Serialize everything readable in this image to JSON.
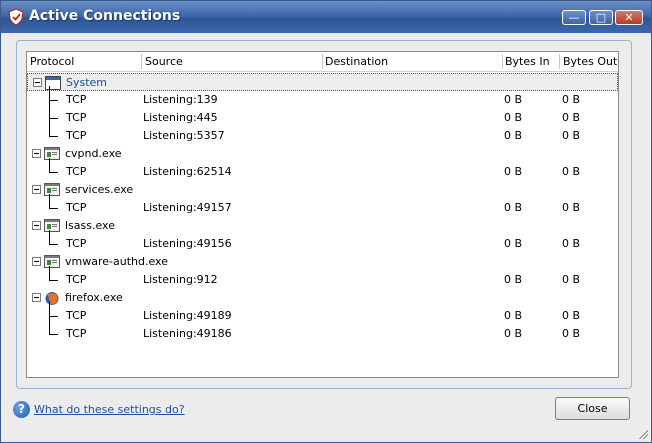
{
  "window": {
    "title": "Active Connections"
  },
  "columns": [
    "Protocol",
    "Source",
    "Destination",
    "Bytes In",
    "Bytes Out"
  ],
  "processes": [
    {
      "name": "System",
      "icon": "window-icon",
      "selected": true,
      "connections": [
        {
          "protocol": "TCP",
          "source": "Listening:139",
          "destination": "",
          "bytes_in": "0 B",
          "bytes_out": "0 B"
        },
        {
          "protocol": "TCP",
          "source": "Listening:445",
          "destination": "",
          "bytes_in": "0 B",
          "bytes_out": "0 B"
        },
        {
          "protocol": "TCP",
          "source": "Listening:5357",
          "destination": "",
          "bytes_in": "0 B",
          "bytes_out": "0 B"
        }
      ]
    },
    {
      "name": "cvpnd.exe",
      "icon": "app-icon",
      "connections": [
        {
          "protocol": "TCP",
          "source": "Listening:62514",
          "destination": "",
          "bytes_in": "0 B",
          "bytes_out": "0 B"
        }
      ]
    },
    {
      "name": "services.exe",
      "icon": "app-icon",
      "connections": [
        {
          "protocol": "TCP",
          "source": "Listening:49157",
          "destination": "",
          "bytes_in": "0 B",
          "bytes_out": "0 B"
        }
      ]
    },
    {
      "name": "lsass.exe",
      "icon": "app-icon",
      "connections": [
        {
          "protocol": "TCP",
          "source": "Listening:49156",
          "destination": "",
          "bytes_in": "0 B",
          "bytes_out": "0 B"
        }
      ]
    },
    {
      "name": "vmware-authd.exe",
      "icon": "app-icon",
      "connections": [
        {
          "protocol": "TCP",
          "source": "Listening:912",
          "destination": "",
          "bytes_in": "0 B",
          "bytes_out": "0 B"
        }
      ]
    },
    {
      "name": "firefox.exe",
      "icon": "firefox-icon",
      "connections": [
        {
          "protocol": "TCP",
          "source": "Listening:49189",
          "destination": "",
          "bytes_in": "0 B",
          "bytes_out": "0 B"
        },
        {
          "protocol": "TCP",
          "source": "Listening:49186",
          "destination": "",
          "bytes_in": "0 B",
          "bytes_out": "0 B"
        }
      ]
    }
  ],
  "footer": {
    "help_text": "What do these settings do?",
    "close_label": "Close"
  },
  "colors": {
    "titlebar": "#3f68ad",
    "selected_name": "#1f4fa0",
    "link": "#1f4fa0"
  }
}
